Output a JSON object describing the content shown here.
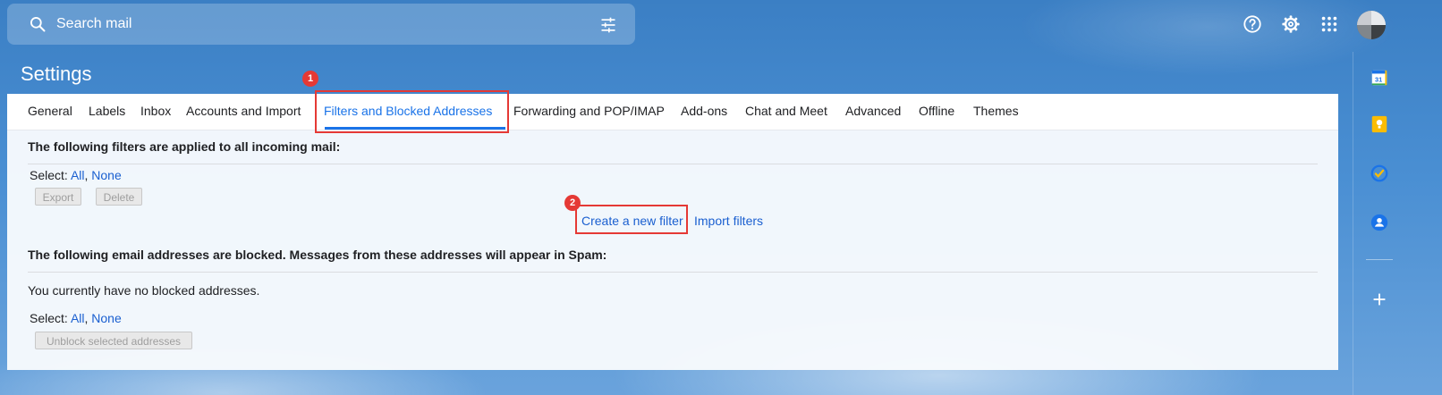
{
  "search": {
    "placeholder": "Search mail"
  },
  "header": {
    "help_icon": "help-circle-icon",
    "settings_icon": "gear-icon",
    "apps_icon": "apps-grid-icon"
  },
  "page": {
    "title": "Settings"
  },
  "tabs": [
    {
      "label": "General"
    },
    {
      "label": "Labels"
    },
    {
      "label": "Inbox"
    },
    {
      "label": "Accounts and Import"
    },
    {
      "label": "Filters and Blocked Addresses",
      "active": true
    },
    {
      "label": "Forwarding and POP/IMAP"
    },
    {
      "label": "Add-ons"
    },
    {
      "label": "Chat and Meet"
    },
    {
      "label": "Advanced"
    },
    {
      "label": "Offline"
    },
    {
      "label": "Themes"
    }
  ],
  "annotations": {
    "badge1": "1",
    "badge2": "2"
  },
  "filters": {
    "heading": "The following filters are applied to all incoming mail:",
    "select_label": "Select:",
    "select_all": "All",
    "select_sep": ",",
    "select_none": "None",
    "export_label": "Export",
    "delete_label": "Delete",
    "create_link": "Create a new filter",
    "import_link": "Import filters"
  },
  "blocked": {
    "heading": "The following email addresses are blocked. Messages from these addresses will appear in Spam:",
    "empty_text": "You currently have no blocked addresses.",
    "select_label": "Select:",
    "select_all": "All",
    "select_sep": ",",
    "select_none": "None",
    "unblock_label": "Unblock selected addresses"
  },
  "colors": {
    "accent": "#1a73e8",
    "link": "#1a5fd0",
    "annotation": "#e53935"
  }
}
